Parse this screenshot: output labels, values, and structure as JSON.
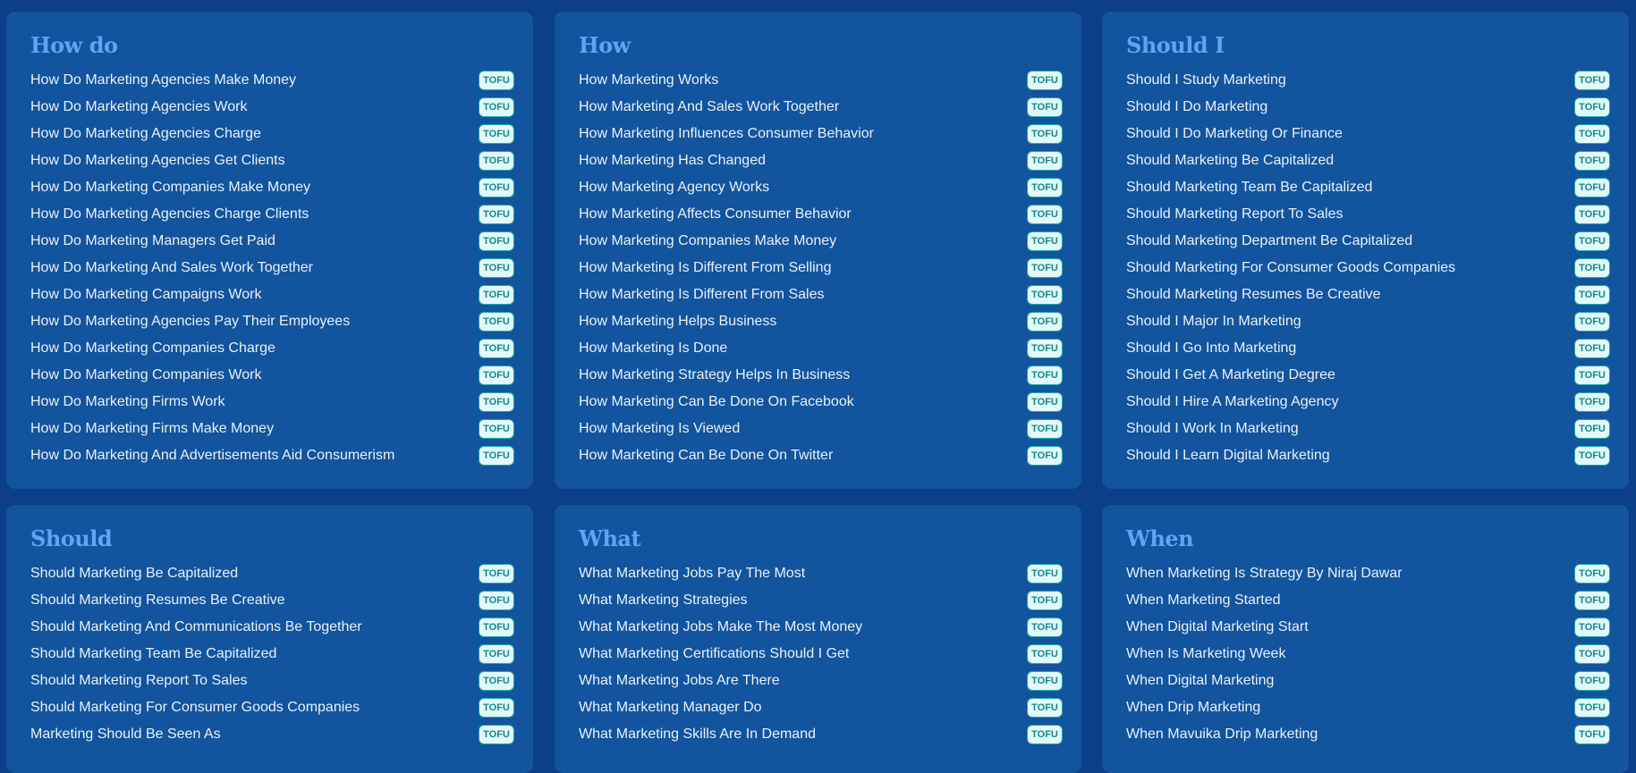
{
  "badge_label": "TOFU",
  "panels": [
    {
      "title": "How do",
      "items": [
        "How Do Marketing Agencies Make Money",
        "How Do Marketing Agencies Work",
        "How Do Marketing Agencies Charge",
        "How Do Marketing Agencies Get Clients",
        "How Do Marketing Companies Make Money",
        "How Do Marketing Agencies Charge Clients",
        "How Do Marketing Managers Get Paid",
        "How Do Marketing And Sales Work Together",
        "How Do Marketing Campaigns Work",
        "How Do Marketing Agencies Pay Their Employees",
        "How Do Marketing Companies Charge",
        "How Do Marketing Companies Work",
        "How Do Marketing Firms Work",
        "How Do Marketing Firms Make Money",
        "How Do Marketing And Advertisements Aid Consumerism"
      ]
    },
    {
      "title": "How",
      "items": [
        "How Marketing Works",
        "How Marketing And Sales Work Together",
        "How Marketing Influences Consumer Behavior",
        "How Marketing Has Changed",
        "How Marketing Agency Works",
        "How Marketing Affects Consumer Behavior",
        "How Marketing Companies Make Money",
        "How Marketing Is Different From Selling",
        "How Marketing Is Different From Sales",
        "How Marketing Helps Business",
        "How Marketing Is Done",
        "How Marketing Strategy Helps In Business",
        "How Marketing Can Be Done On Facebook",
        "How Marketing Is Viewed",
        "How Marketing Can Be Done On Twitter"
      ]
    },
    {
      "title": "Should I",
      "items": [
        "Should I Study Marketing",
        "Should I Do Marketing",
        "Should I Do Marketing Or Finance",
        "Should Marketing Be Capitalized",
        "Should Marketing Team Be Capitalized",
        "Should Marketing Report To Sales",
        "Should Marketing Department Be Capitalized",
        "Should Marketing For Consumer Goods Companies",
        "Should Marketing Resumes Be Creative",
        "Should I Major In Marketing",
        "Should I Go Into Marketing",
        "Should I Get A Marketing Degree",
        "Should I Hire A Marketing Agency",
        "Should I Work In Marketing",
        "Should I Learn Digital Marketing"
      ]
    },
    {
      "title": "Should",
      "items": [
        "Should Marketing Be Capitalized",
        "Should Marketing Resumes Be Creative",
        "Should Marketing And Communications Be Together",
        "Should Marketing Team Be Capitalized",
        "Should Marketing Report To Sales",
        "Should Marketing For Consumer Goods Companies",
        "Marketing Should Be Seen As"
      ]
    },
    {
      "title": "What",
      "items": [
        "What Marketing Jobs Pay The Most",
        "What Marketing Strategies",
        "What Marketing Jobs Make The Most Money",
        "What Marketing Certifications Should I Get",
        "What Marketing Jobs Are There",
        "What Marketing Manager Do",
        "What Marketing Skills Are In Demand"
      ]
    },
    {
      "title": "When",
      "items": [
        "When Marketing Is Strategy By Niraj Dawar",
        "When Marketing Started",
        "When Digital Marketing Start",
        "When Is Marketing Week",
        "When Digital Marketing",
        "When Drip Marketing",
        "When Mavuika Drip Marketing"
      ]
    }
  ]
}
